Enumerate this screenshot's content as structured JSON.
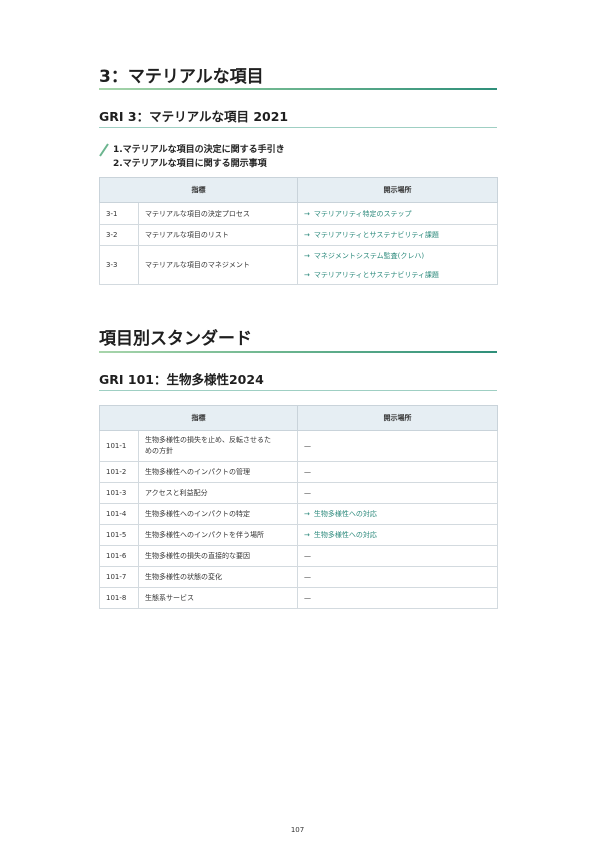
{
  "section1": {
    "title": "3：マテリアルな項目",
    "subtitle": "GRI 3：マテリアルな項目 2021",
    "disclaimer_lines": [
      "1.マテリアルな項目の決定に関する手引き",
      "2.マテリアルな項目に関する開示事項"
    ],
    "table": {
      "headers": [
        "指標",
        "開示場所"
      ],
      "rows": [
        {
          "code": "3-1",
          "name": "マテリアルな項目の決定プロセス",
          "locations": [
            "マテリアリティ特定のステップ"
          ]
        },
        {
          "code": "3-2",
          "name": "マテリアルな項目のリスト",
          "locations": [
            "マテリアリティとサステナビリティ課題"
          ]
        },
        {
          "code": "3-3",
          "name": "マテリアルな項目のマネジメント",
          "locations": [
            "マネジメントシステム監査(クレハ)",
            "マテリアリティとサステナビリティ課題"
          ]
        }
      ]
    }
  },
  "section2": {
    "title": "項目別スタンダード",
    "subtitle": "GRI 101：生物多様性2024",
    "table": {
      "headers": [
        "指標",
        "開示場所"
      ],
      "rows": [
        {
          "code": "101-1",
          "name_lines": [
            "生物多様性の損失を止め、反転させるた",
            "めの方針"
          ],
          "location": "—",
          "is_link": false
        },
        {
          "code": "101-2",
          "name_lines": [
            "生物多様性へのインパクトの管理"
          ],
          "location": "—",
          "is_link": false
        },
        {
          "code": "101-3",
          "name_lines": [
            "アクセスと利益配分"
          ],
          "location": "—",
          "is_link": false
        },
        {
          "code": "101-4",
          "name_lines": [
            "生物多様性へのインパクトの特定"
          ],
          "location": "生物多様性への対応",
          "is_link": true
        },
        {
          "code": "101-5",
          "name_lines": [
            "生物多様性へのインパクトを伴う場所"
          ],
          "location": "生物多様性への対応",
          "is_link": true
        },
        {
          "code": "101-6",
          "name_lines": [
            "生物多様性の損失の直接的な要因"
          ],
          "location": "—",
          "is_link": false
        },
        {
          "code": "101-7",
          "name_lines": [
            "生物多様性の状態の変化"
          ],
          "location": "—",
          "is_link": false
        },
        {
          "code": "101-8",
          "name_lines": [
            "生態系サービス"
          ],
          "location": "—",
          "is_link": false
        }
      ]
    }
  },
  "arrow_glyph": "→",
  "page_number": "107",
  "colors": {
    "accent_green": "#6cb58f",
    "accent_teal": "#2c8a7c",
    "header_bg": "#e6eef3"
  }
}
